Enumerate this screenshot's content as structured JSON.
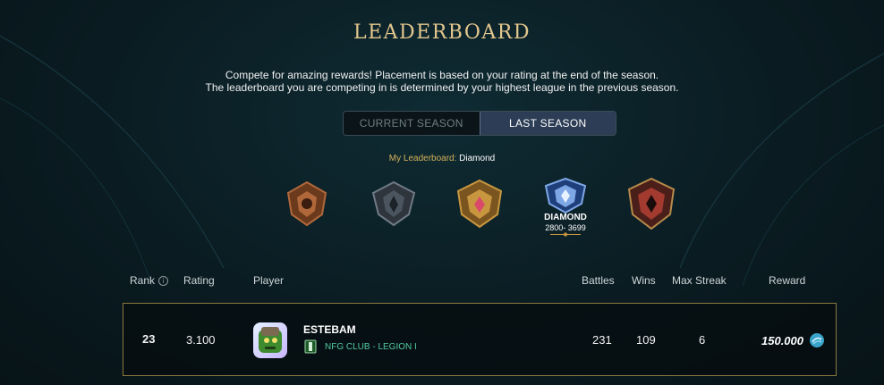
{
  "title": "LEADERBOARD",
  "subtitle_line1": "Compete for amazing rewards! Placement is based on your rating at the end of the season.",
  "subtitle_line2": "The leaderboard you are competing in is determined by your highest league in the previous season.",
  "tabs": [
    {
      "label": "CURRENT SEASON",
      "active": false
    },
    {
      "label": "LAST SEASON",
      "active": true
    }
  ],
  "my_leaderboard": {
    "label": "My Leaderboard:",
    "value": "Diamond"
  },
  "leagues": [
    {
      "icon": "bronze-league-icon",
      "color": "#b0683a"
    },
    {
      "icon": "silver-league-icon",
      "color": "#6f7a86"
    },
    {
      "icon": "gold-league-icon",
      "color": "#c8963f"
    },
    {
      "icon": "diamond-league-icon",
      "color": "#7ea7e6",
      "name": "DIAMOND",
      "range": "2800- 3699"
    },
    {
      "icon": "champion-league-icon",
      "color": "#a23a30"
    }
  ],
  "columns": {
    "rank": "Rank",
    "rating": "Rating",
    "player": "Player",
    "battles": "Battles",
    "wins": "Wins",
    "max_streak": "Max Streak",
    "reward": "Reward"
  },
  "entry": {
    "rank": "23",
    "rating": "3.100",
    "player_name": "ESTEBAM",
    "club": "NFG CLUB - LEGION I",
    "battles": "231",
    "wins": "109",
    "max_streak": "6",
    "reward": "150.000",
    "reward_icon": "crystal-icon"
  },
  "colors": {
    "accent_gold": "#e3c78e",
    "row_border": "#8b7a3e",
    "club_green": "#52c9a0",
    "tab_active": "#2c3d55"
  }
}
